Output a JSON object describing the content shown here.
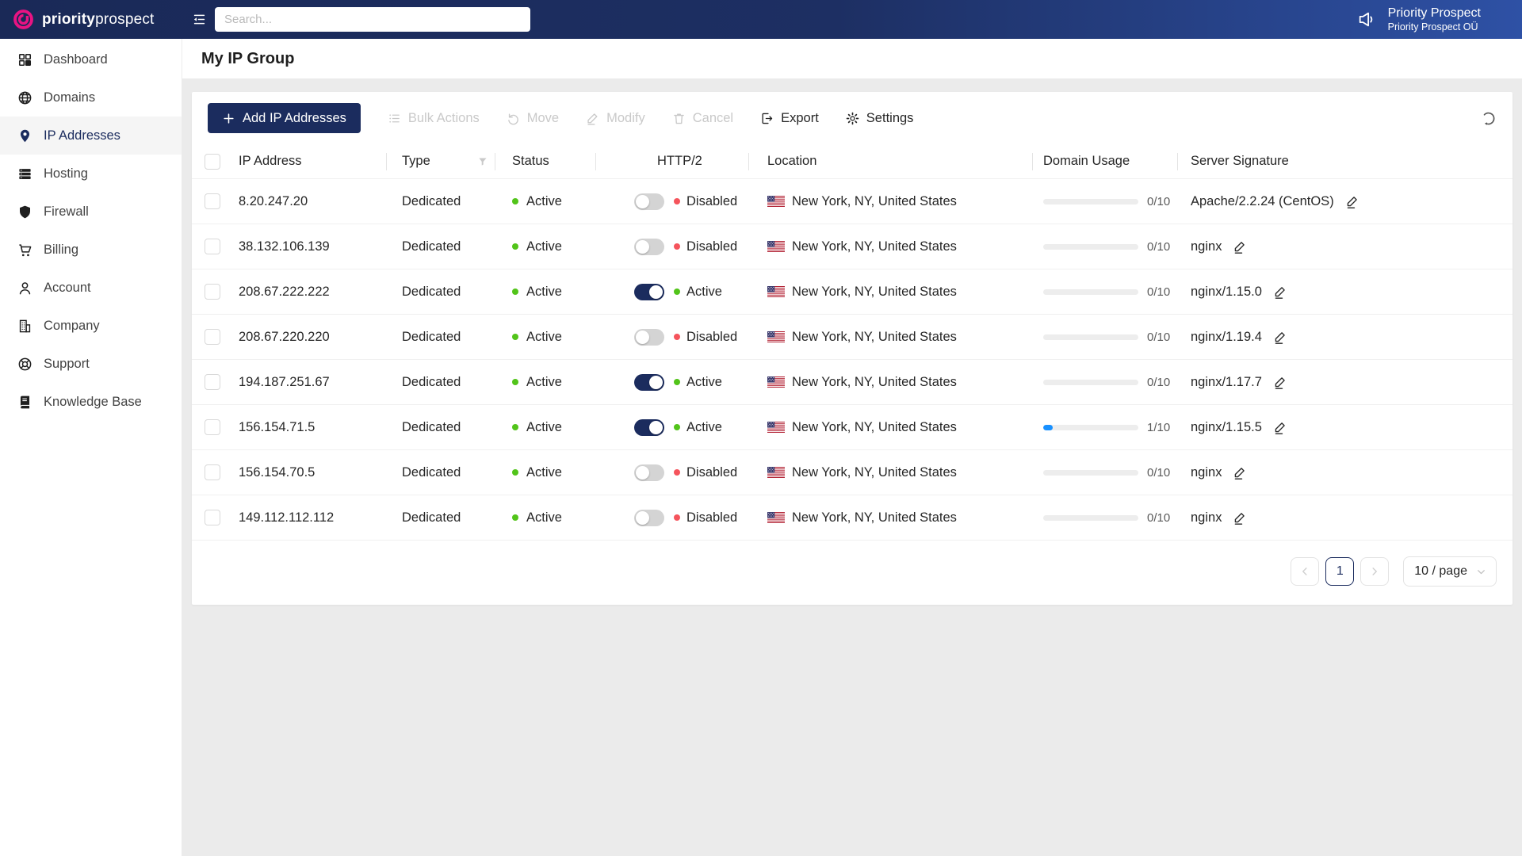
{
  "colors": {
    "navy": "#1b2c5e",
    "pink": "#e91383",
    "green": "#52c41a",
    "red": "#f5545c",
    "blue": "#1890ff"
  },
  "header": {
    "brand_bold": "priority",
    "brand_light": "prospect",
    "search_placeholder": "Search...",
    "account_name": "Priority Prospect",
    "account_org": "Priority Prospect OÜ"
  },
  "sidebar": {
    "items": [
      {
        "label": "Dashboard",
        "icon": "dashboard-icon",
        "active": false
      },
      {
        "label": "Domains",
        "icon": "globe-icon",
        "active": false
      },
      {
        "label": "IP Addresses",
        "icon": "location-pin-icon",
        "active": true
      },
      {
        "label": "Hosting",
        "icon": "server-icon",
        "active": false
      },
      {
        "label": "Firewall",
        "icon": "shield-icon",
        "active": false
      },
      {
        "label": "Billing",
        "icon": "cart-icon",
        "active": false
      },
      {
        "label": "Account",
        "icon": "user-icon",
        "active": false
      },
      {
        "label": "Company",
        "icon": "building-icon",
        "active": false
      },
      {
        "label": "Support",
        "icon": "life-ring-icon",
        "active": false
      },
      {
        "label": "Knowledge Base",
        "icon": "book-icon",
        "active": false
      }
    ]
  },
  "page": {
    "title": "My IP Group"
  },
  "toolbar": {
    "add": "Add IP Addresses",
    "bulk": "Bulk Actions",
    "move": "Move",
    "modify": "Modify",
    "cancel": "Cancel",
    "export": "Export",
    "settings": "Settings"
  },
  "table": {
    "columns": {
      "ip": "IP Address",
      "type": "Type",
      "status": "Status",
      "http2": "HTTP/2",
      "location": "Location",
      "usage": "Domain Usage",
      "signature": "Server Signature"
    },
    "rows": [
      {
        "ip": "8.20.247.20",
        "type": "Dedicated",
        "status": "Active",
        "http2": "Disabled",
        "http2_on": false,
        "location": "New York, NY, United States",
        "usage": "0/10",
        "usage_pct": 0,
        "signature": "Apache/2.2.24 (CentOS)"
      },
      {
        "ip": "38.132.106.139",
        "type": "Dedicated",
        "status": "Active",
        "http2": "Disabled",
        "http2_on": false,
        "location": "New York, NY, United States",
        "usage": "0/10",
        "usage_pct": 0,
        "signature": "nginx"
      },
      {
        "ip": "208.67.222.222",
        "type": "Dedicated",
        "status": "Active",
        "http2": "Active",
        "http2_on": true,
        "location": "New York, NY, United States",
        "usage": "0/10",
        "usage_pct": 0,
        "signature": "nginx/1.15.0"
      },
      {
        "ip": "208.67.220.220",
        "type": "Dedicated",
        "status": "Active",
        "http2": "Disabled",
        "http2_on": false,
        "location": "New York, NY, United States",
        "usage": "0/10",
        "usage_pct": 0,
        "signature": "nginx/1.19.4"
      },
      {
        "ip": "194.187.251.67",
        "type": "Dedicated",
        "status": "Active",
        "http2": "Active",
        "http2_on": true,
        "location": "New York, NY, United States",
        "usage": "0/10",
        "usage_pct": 0,
        "signature": "nginx/1.17.7"
      },
      {
        "ip": "156.154.71.5",
        "type": "Dedicated",
        "status": "Active",
        "http2": "Active",
        "http2_on": true,
        "location": "New York, NY, United States",
        "usage": "1/10",
        "usage_pct": 10,
        "signature": "nginx/1.15.5"
      },
      {
        "ip": "156.154.70.5",
        "type": "Dedicated",
        "status": "Active",
        "http2": "Disabled",
        "http2_on": false,
        "location": "New York, NY, United States",
        "usage": "0/10",
        "usage_pct": 0,
        "signature": "nginx"
      },
      {
        "ip": "149.112.112.112",
        "type": "Dedicated",
        "status": "Active",
        "http2": "Disabled",
        "http2_on": false,
        "location": "New York, NY, United States",
        "usage": "0/10",
        "usage_pct": 0,
        "signature": "nginx"
      }
    ]
  },
  "pagination": {
    "current": "1",
    "page_size": "10 / page"
  }
}
